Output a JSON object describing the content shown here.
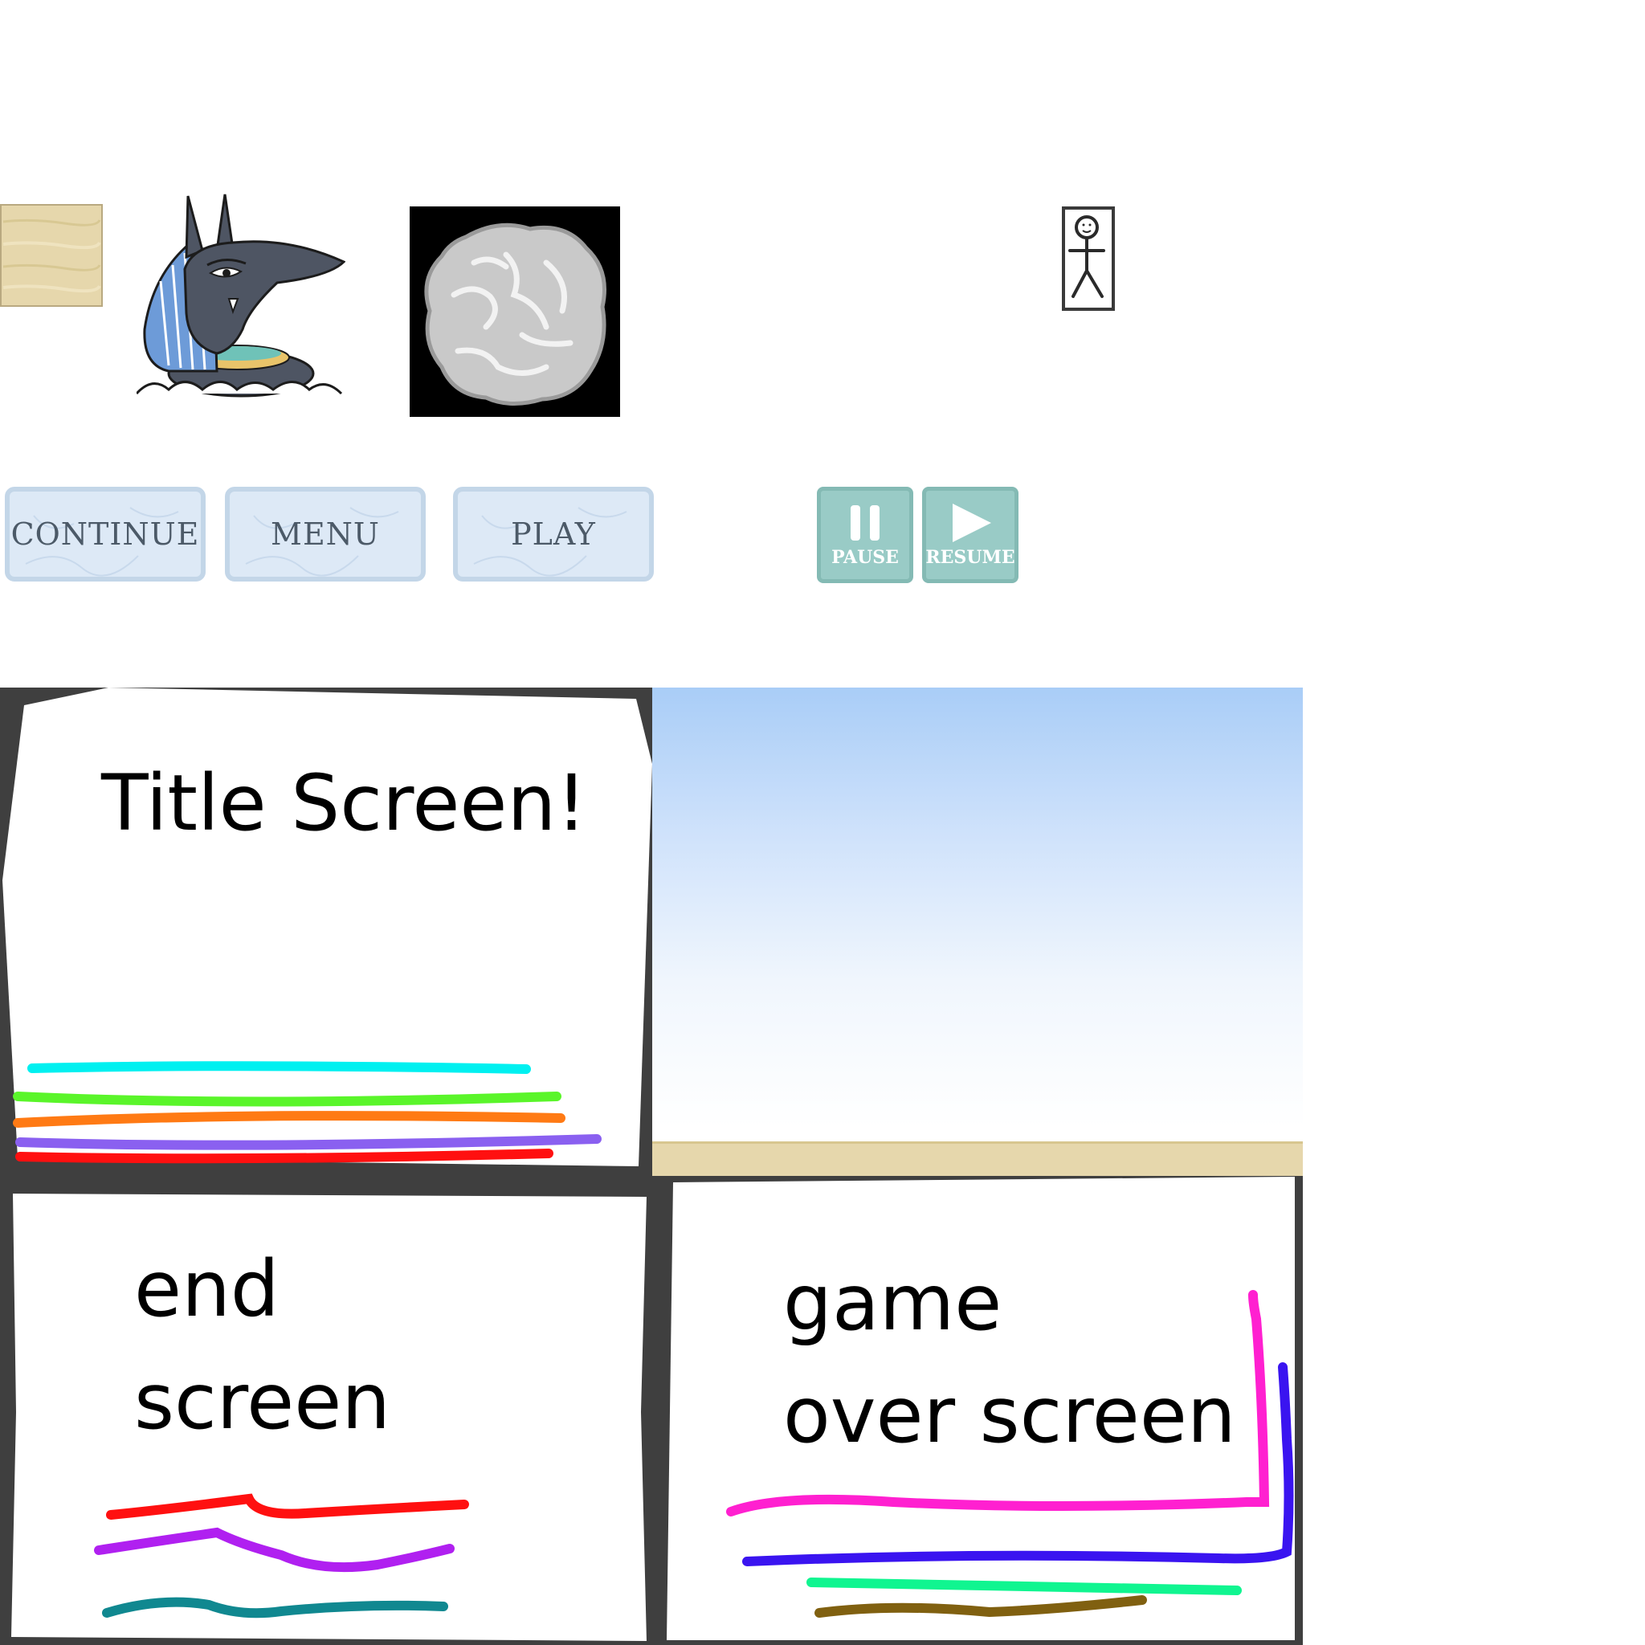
{
  "sprites": {
    "sand_block": "sand-texture-icon",
    "anubis": "anubis-character-icon",
    "boulder": "boulder-icon",
    "stickman": "stickman-icon"
  },
  "buttons": {
    "continue": "CONTINUE",
    "menu": "MENU",
    "play": "PLAY",
    "pause": "PAUSE",
    "resume": "RESUME"
  },
  "screens": {
    "title": "Title Screen!",
    "end_line1": "end",
    "end_line2": "screen",
    "gameover_line1": "game",
    "gameover_line2": "over screen"
  },
  "colors": {
    "frame": "#3f3f3f",
    "sky_top": "#a9cdf7",
    "sand": "#e6d7ac",
    "ice_button": "#dde9f6",
    "teal_button": "#99cbc6"
  }
}
